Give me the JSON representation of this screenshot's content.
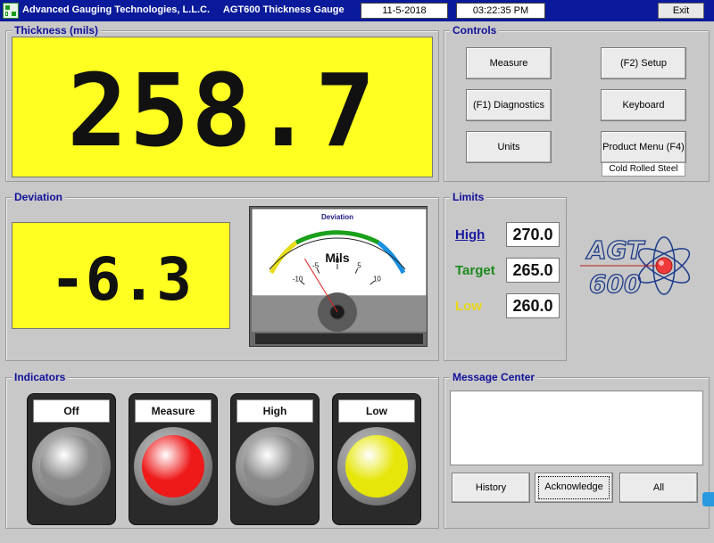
{
  "titlebar": {
    "company": "Advanced Gauging Technologies, L.L.C.",
    "product": "AGT600 Thickness Gauge",
    "date": "11-5-2018",
    "time": "03:22:35 PM",
    "exit_label": "Exit"
  },
  "thickness": {
    "title": "Thickness (mils)",
    "value": "258.7"
  },
  "controls": {
    "title": "Controls",
    "measure_label": "Measure",
    "setup_label": "(F2) Setup",
    "diagnostics_label": "(F1) Diagnostics",
    "keyboard_label": "Keyboard",
    "units_label": "Units",
    "product_menu_label": "Product Menu (F4)",
    "product_name": "Cold Rolled Steel"
  },
  "deviation": {
    "title": "Deviation",
    "value": "-6.3",
    "meter": {
      "title": "Deviation",
      "unit": "Mils",
      "ticks": [
        "-10",
        "-5",
        "0",
        "5",
        "10"
      ],
      "value": -6.3,
      "min": -10,
      "max": 10
    }
  },
  "limits": {
    "title": "Limits",
    "high_label": "High",
    "high_value": "270.0",
    "target_label": "Target",
    "target_value": "265.0",
    "low_label": "Low",
    "low_value": "260.0",
    "colors": {
      "high": "#1a1aa0",
      "target": "#1a8a1a",
      "low": "#e8d81a"
    }
  },
  "logo": {
    "text_top": "AGT",
    "text_bottom": "600"
  },
  "indicators": {
    "title": "Indicators",
    "items": [
      {
        "label": "Off",
        "state": "inactive",
        "color": "#8a8a8a"
      },
      {
        "label": "Measure",
        "state": "active",
        "color": "#ee1a1a"
      },
      {
        "label": "High",
        "state": "inactive",
        "color": "#8a8a8a"
      },
      {
        "label": "Low",
        "state": "active",
        "color": "#e6e60a"
      }
    ]
  },
  "messages": {
    "title": "Message Center",
    "text": "",
    "history_label": "History",
    "acknowledge_label": "Acknowledge",
    "all_label": "All"
  }
}
